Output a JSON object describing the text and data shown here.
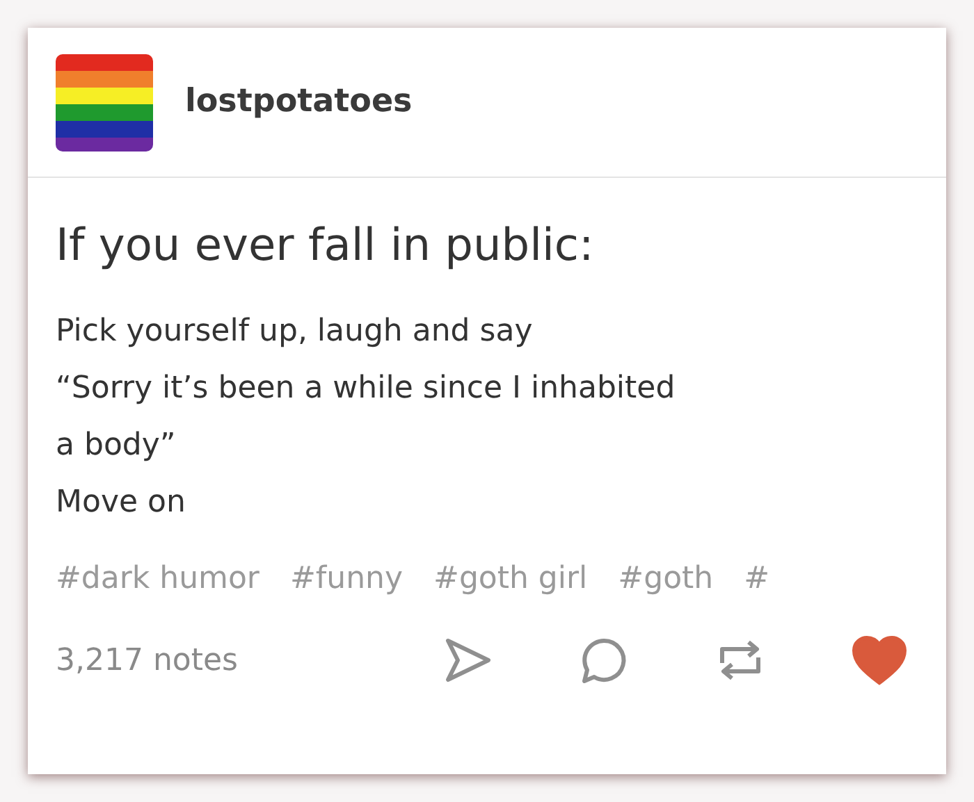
{
  "post": {
    "username": "lostpotatoes",
    "title": "If you ever fall in public:",
    "body_lines": [
      "Pick yourself up, laugh and say",
      "“Sorry it’s been a while since I inhabited",
      "a body”",
      "Move on"
    ],
    "tags": [
      "#dark humor",
      "#funny",
      "#goth girl",
      "#goth",
      "#"
    ],
    "notes": "3,217 notes",
    "liked": true
  }
}
